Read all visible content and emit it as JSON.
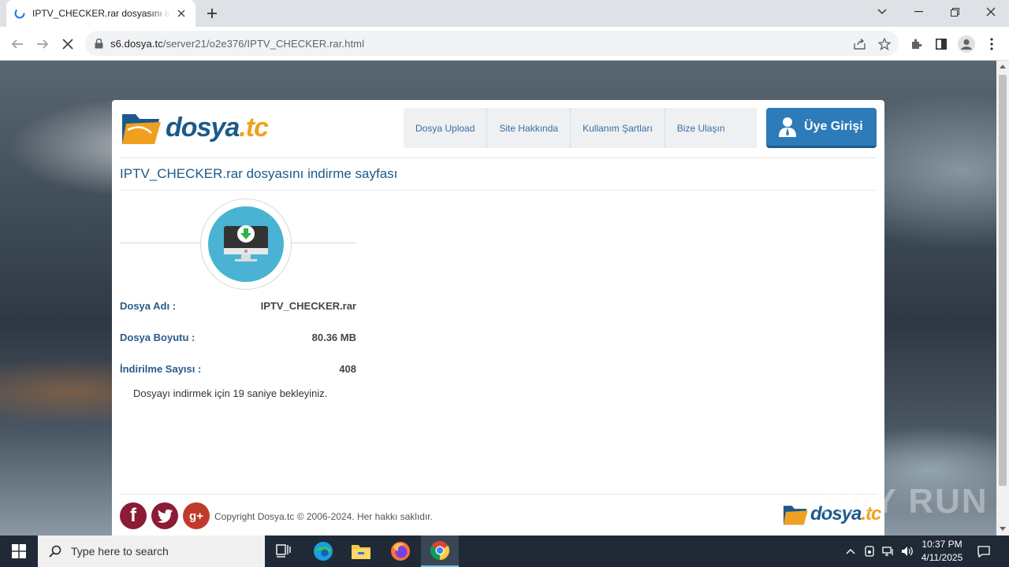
{
  "browser": {
    "tab_title": "IPTV_CHECKER.rar dosyasını indir",
    "url_host": "s6.dosya.tc",
    "url_path": "/server21/o2e376/IPTV_CHECKER.rar.html"
  },
  "site": {
    "logo_word": "dosya",
    "logo_ext": ".tc",
    "nav": [
      "Dosya Upload",
      "Site Hakkında",
      "Kullanım Şartları",
      "Bize Ulaşın"
    ],
    "login_label": "Üye Girişi",
    "page_title": "IPTV_CHECKER.rar dosyasını indirme sayfası",
    "file_info": [
      {
        "label": "Dosya Adı :",
        "value": "IPTV_CHECKER.rar"
      },
      {
        "label": "Dosya Boyutu :",
        "value": "80.36 MB"
      },
      {
        "label": "İndirilme Sayısı :",
        "value": "408"
      }
    ],
    "wait_message": "Dosyayı indirmek için 19 saniye bekleyiniz.",
    "copyright": "Copyright Dosya.tc © 2006-2024. Her hakkı saklıdır.",
    "social": [
      "f",
      "t",
      "g+"
    ]
  },
  "watermark": "ANY RUN",
  "taskbar": {
    "search_placeholder": "Type here to search",
    "time": "10:37 PM",
    "date": "4/11/2025"
  },
  "colors": {
    "brand_blue": "#1a5a8a",
    "brand_orange": "#f0a020",
    "login_blue": "#2d7bb8",
    "download_circle": "#4ab3d3"
  }
}
